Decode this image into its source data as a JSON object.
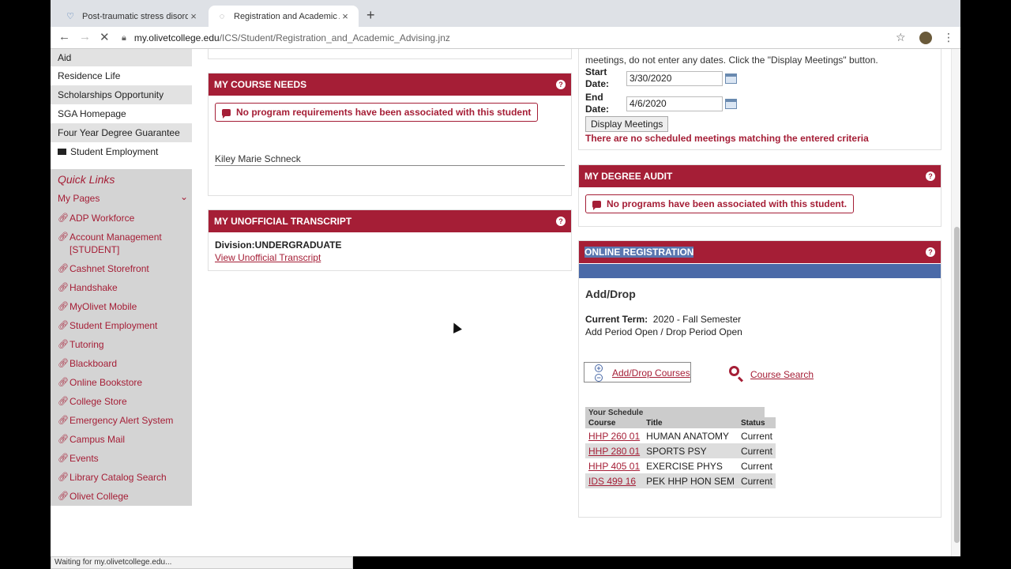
{
  "browser": {
    "tabs": [
      {
        "title": "Post-traumatic stress disorder",
        "active": false
      },
      {
        "title": "Registration and Academic Adv",
        "active": true
      }
    ],
    "url_host": "my.olivetcollege.edu",
    "url_path": "/ICS/Student/Registration_and_Academic_Advising.jnz",
    "status_text": "Waiting for my.olivetcollege.edu..."
  },
  "sidebar": {
    "items": [
      {
        "label": "Aid"
      },
      {
        "label": "Residence Life"
      },
      {
        "label": "Scholarships Opportunity"
      },
      {
        "label": "SGA Homepage"
      },
      {
        "label": "Four Year Degree Guarantee"
      },
      {
        "label": "Student Employment"
      }
    ],
    "quick_links_title": "Quick Links",
    "my_pages_label": "My Pages",
    "quick_links": [
      {
        "label": "ADP Workforce"
      },
      {
        "label": "Account Management [STUDENT]"
      },
      {
        "label": "Cashnet Storefront"
      },
      {
        "label": "Handshake"
      },
      {
        "label": "MyOlivet Mobile"
      },
      {
        "label": "Student Employment"
      },
      {
        "label": "Tutoring"
      },
      {
        "label": "Blackboard"
      },
      {
        "label": "Online Bookstore"
      },
      {
        "label": "College Store"
      },
      {
        "label": "Emergency Alert System"
      },
      {
        "label": "Campus Mail"
      },
      {
        "label": "Events"
      },
      {
        "label": "Library Catalog Search"
      },
      {
        "label": "Olivet College"
      }
    ]
  },
  "course_needs": {
    "title": "MY COURSE NEEDS",
    "alert": "No program requirements have been associated with this student",
    "student_name": "Kiley Marie Schneck"
  },
  "transcript": {
    "title": "MY UNOFFICIAL TRANSCRIPT",
    "division": "Division:UNDERGRADUATE",
    "link": "View Unofficial Transcript"
  },
  "meetings": {
    "intro_line": "meetings, do not enter any dates. Click the \"Display Meetings\" button.",
    "start_label": "Start Date:",
    "start_value": "3/30/2020",
    "end_label": "End Date:",
    "end_value": "4/6/2020",
    "button": "Display Meetings",
    "message": "There are no scheduled meetings matching the entered criteria"
  },
  "degree_audit": {
    "title": "MY DEGREE AUDIT",
    "alert": "No programs have been associated with this student."
  },
  "online_registration": {
    "title": "ONLINE REGISTRATION",
    "heading": "Add/Drop",
    "current_term_label": "Current Term:",
    "current_term_value": "2020 - Fall Semester",
    "period_status": "Add Period Open / Drop Period Open",
    "add_drop_link": "Add/Drop Courses",
    "course_search_link": "Course Search",
    "schedule_title": "Your Schedule",
    "columns": [
      "Course",
      "Title",
      "Status"
    ],
    "rows": [
      {
        "course": "HHP 260 01",
        "title": "HUMAN ANATOMY",
        "status": "Current"
      },
      {
        "course": "HHP 280 01",
        "title": "SPORTS PSY",
        "status": "Current"
      },
      {
        "course": "HHP 405 01",
        "title": "EXERCISE PHYS",
        "status": "Current"
      },
      {
        "course": "IDS 499 16",
        "title": "PEK HHP HON SEM",
        "status": "Current"
      }
    ]
  }
}
